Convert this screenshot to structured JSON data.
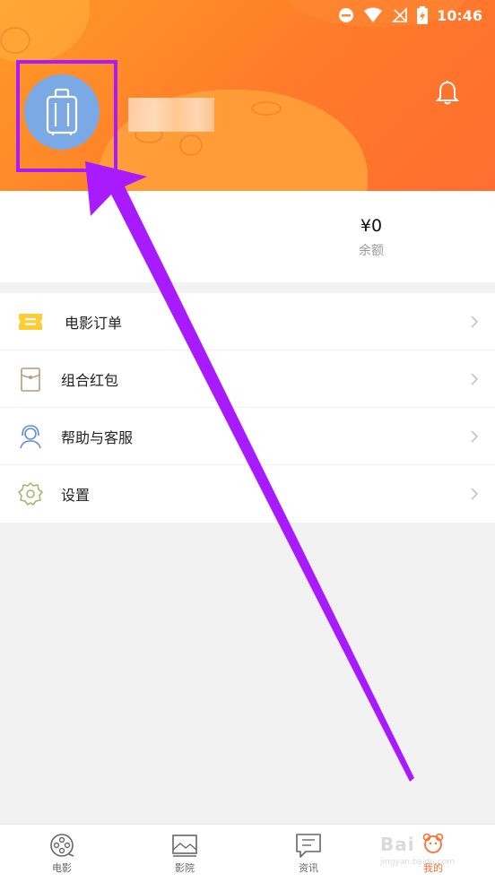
{
  "status_bar": {
    "time": "10:46"
  },
  "header": {
    "username": ""
  },
  "stats": [
    {
      "value": "",
      "label": ""
    },
    {
      "value": "¥0",
      "label": "余额"
    }
  ],
  "menu": [
    {
      "label": "电影订单",
      "icon": "ticket-icon"
    },
    {
      "label": "组合红包",
      "icon": "red-envelope-icon"
    },
    {
      "label": "帮助与客服",
      "icon": "customer-service-icon"
    },
    {
      "label": "设置",
      "icon": "settings-gear-icon"
    }
  ],
  "tabbar": [
    {
      "label": "电影",
      "icon": "film-reel-icon",
      "active": false
    },
    {
      "label": "影院",
      "icon": "cinema-screen-icon",
      "active": false
    },
    {
      "label": "资讯",
      "icon": "news-message-icon",
      "active": false
    },
    {
      "label": "我的",
      "icon": "profile-icon",
      "active": true
    }
  ],
  "watermark": {
    "text": "Bai",
    "sub": "jingyan.baidu.com"
  },
  "colors": {
    "accent": "#ff6e30",
    "header_start": "#ff9a26",
    "highlight": "#a81aff",
    "avatar_bg": "#7aa9e6"
  }
}
